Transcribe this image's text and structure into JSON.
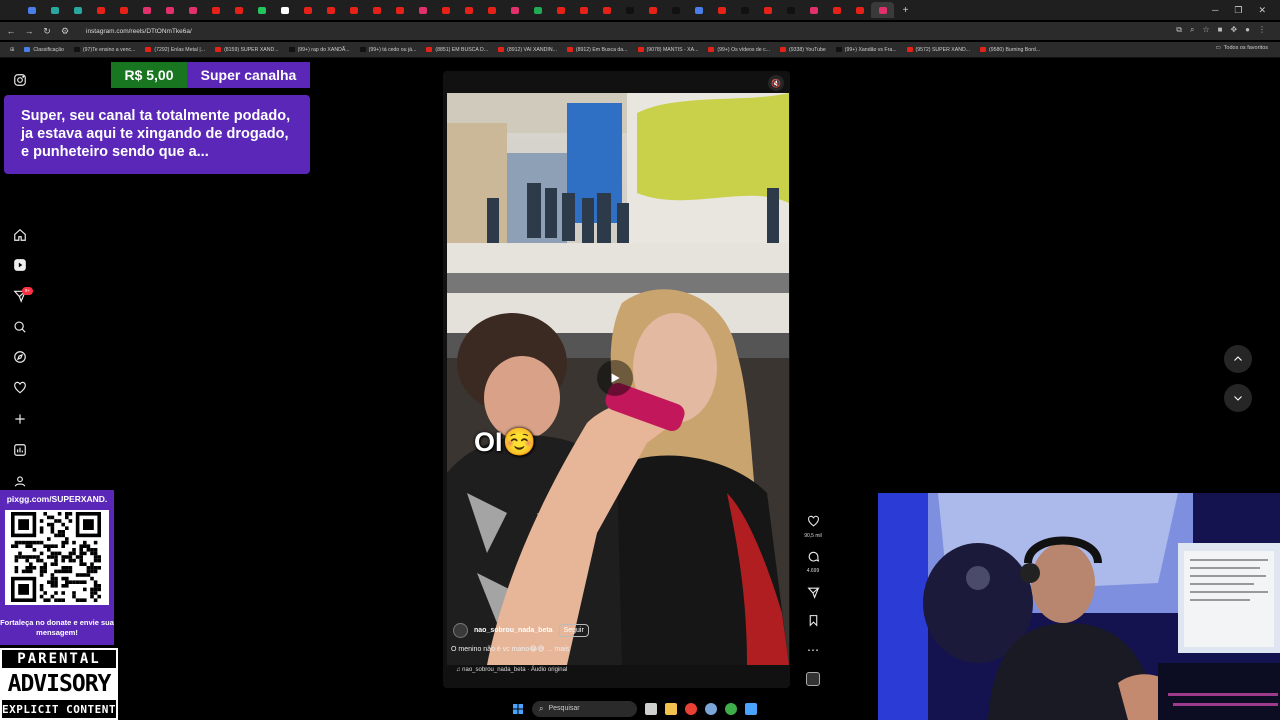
{
  "browser": {
    "url": "instagram.com/reels/DTtONmTke6a/",
    "bookmarks": [
      {
        "label": "Classificação",
        "color": "#4a7ee8"
      },
      {
        "label": "(97)Te ensino a venc...",
        "color": "#111111"
      },
      {
        "label": "(7292) Enlas Metal |...",
        "color": "#e62117"
      },
      {
        "label": "(8159) SUPER XAND...",
        "color": "#e62117"
      },
      {
        "label": "(99+) rap do XANDÃ...",
        "color": "#111111"
      },
      {
        "label": "(99+) tá cedo ou já...",
        "color": "#111111"
      },
      {
        "label": "(8851) EM BUSCA D...",
        "color": "#e62117"
      },
      {
        "label": "(8912) VAI XANDIN...",
        "color": "#e62117"
      },
      {
        "label": "(8912) Em Busca da...",
        "color": "#e62117"
      },
      {
        "label": "(9078) MANTIS - XA...",
        "color": "#e62117"
      },
      {
        "label": "(99+) Os vídeos de c...",
        "color": "#e62117"
      },
      {
        "label": "(9338) YouTube",
        "color": "#e62117"
      },
      {
        "label": "(99+) Xandão vs Fra...",
        "color": "#111111"
      },
      {
        "label": "(9572) SUPER XAND...",
        "color": "#e62117"
      },
      {
        "label": "(9580) Burning Bord...",
        "color": "#e62117"
      }
    ],
    "all_favorites": "Todos os favoritos"
  },
  "instagram": {
    "notification_count": "9+",
    "rail_icons": [
      "instagram-logo-icon",
      "home-icon",
      "reels-icon",
      "messages-icon",
      "search-icon",
      "explore-icon",
      "notifications-icon",
      "create-icon",
      "dashboard-icon",
      "profile-icon"
    ]
  },
  "superchat": {
    "amount": "R$ 5,00",
    "name": "Super canalha",
    "message": "Super, seu canal ta totalmente podado, ja estava aqui te xingando de drogado, e punheteiro sendo que a...",
    "colors": {
      "amount_bg": "#17761f",
      "purple": "#5a27b8"
    }
  },
  "donate": {
    "link": "pixgg.com/SUPERXAND.",
    "caption": "Fortaleça no donate e envie sua mensagem!"
  },
  "parental": {
    "top": "PARENTAL",
    "mid": "ADVISORY",
    "bottom": "EXPLICIT CONTENT"
  },
  "reel": {
    "overlay_text": "OI☺️",
    "author": "nao_sobrou_nada_beta",
    "follow": "Seguir",
    "caption": "O menino não é vc mano😂😅 ... mais",
    "audio": "nao_sobrou_nada_beta · Áudio original",
    "likes": "90,5 mil",
    "comments": "4.699"
  },
  "taskbar": {
    "search": "Pesquisar"
  }
}
